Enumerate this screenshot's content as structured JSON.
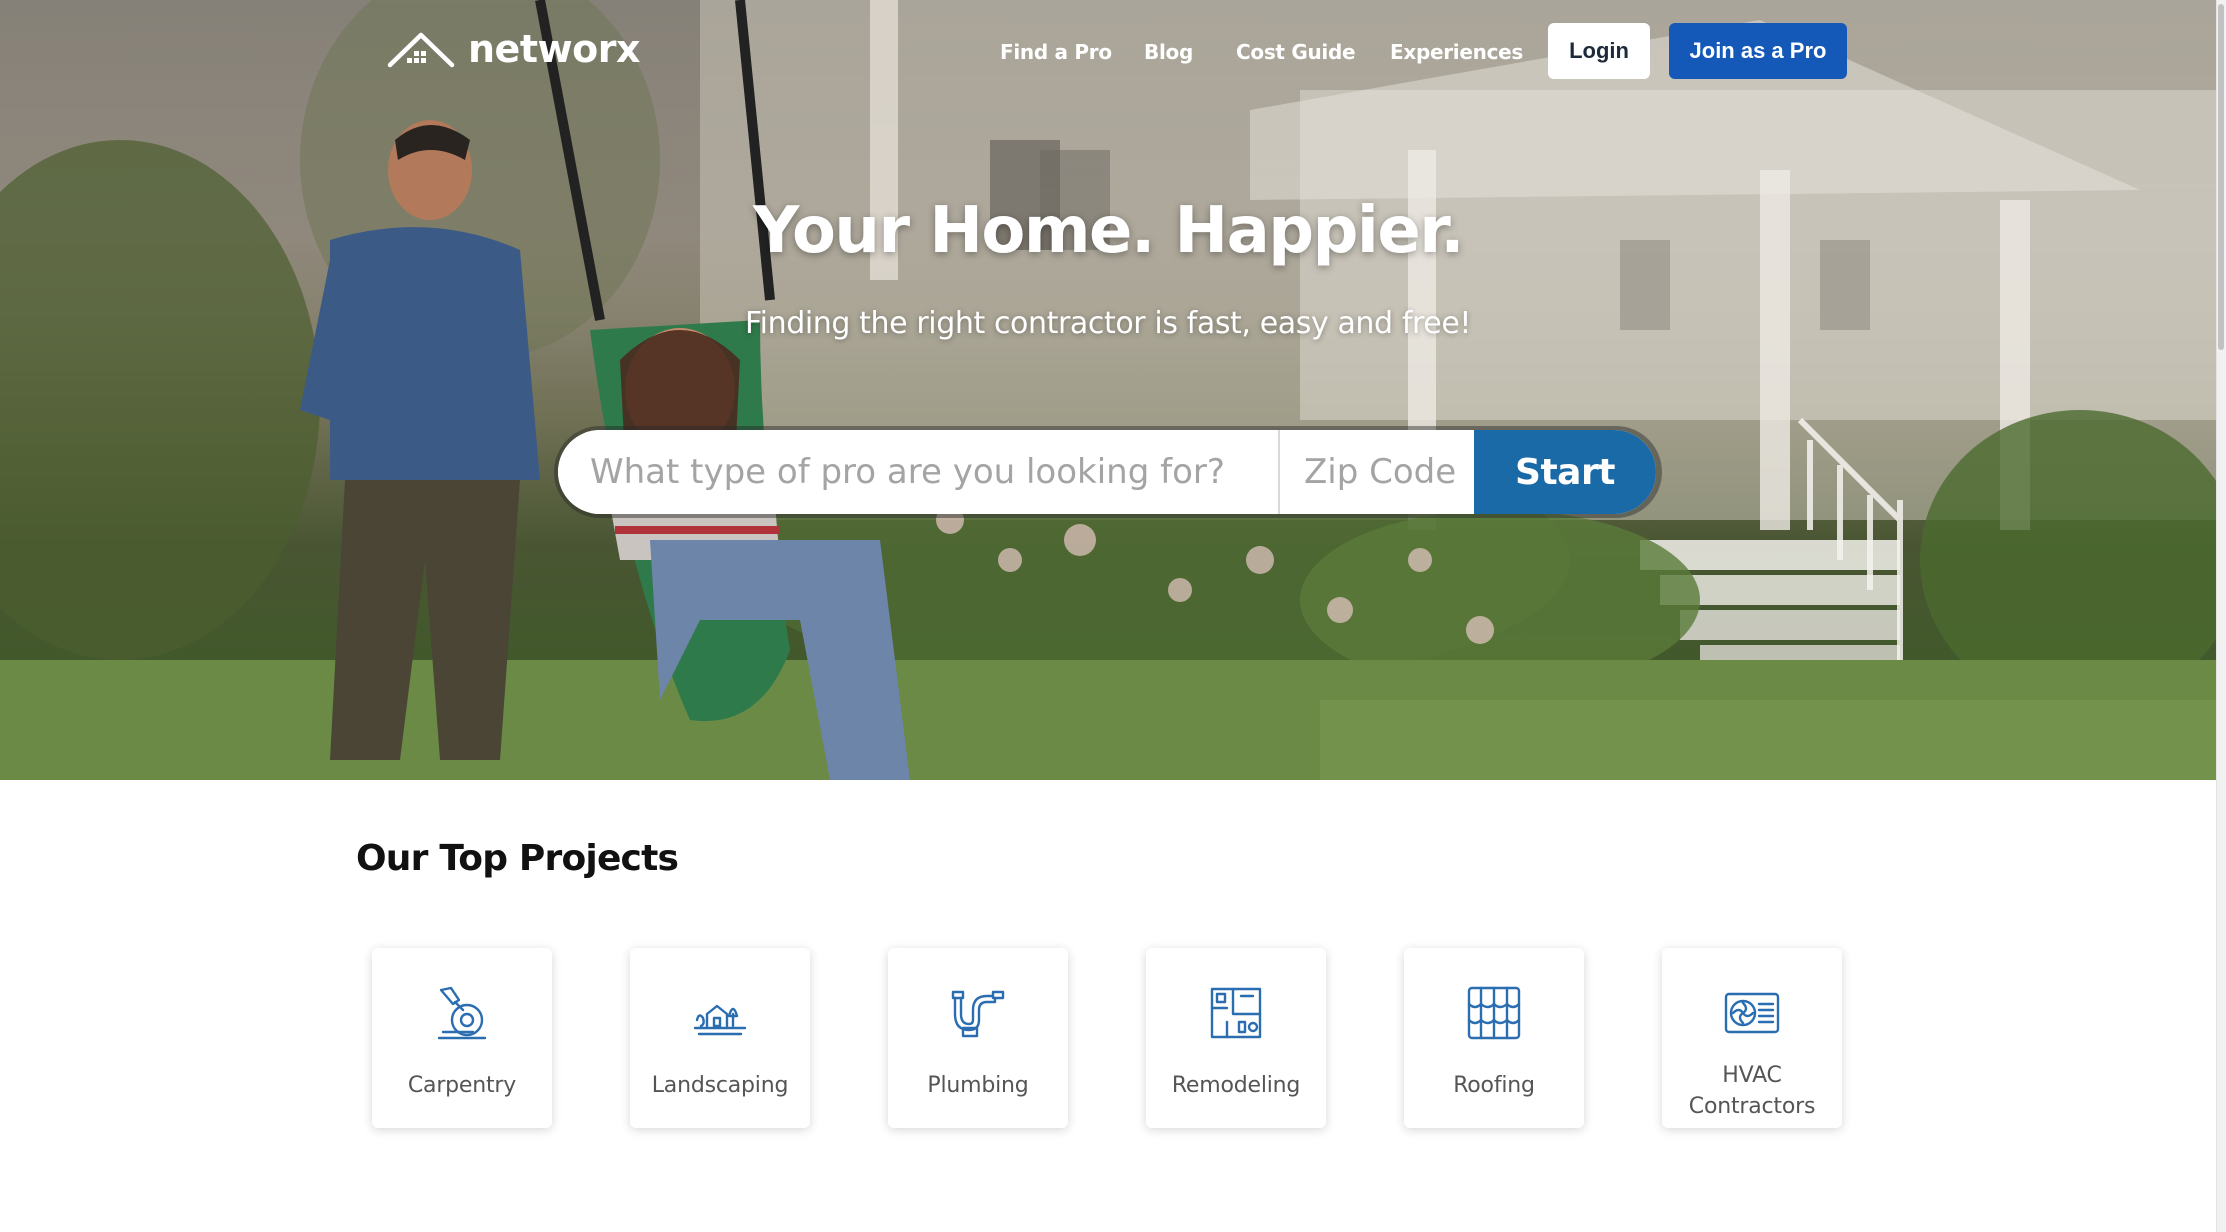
{
  "brand": {
    "name": "networx"
  },
  "nav": {
    "links": [
      "Find a Pro",
      "Blog",
      "Cost Guide",
      "Experiences"
    ],
    "login_label": "Login",
    "join_label": "Join as a Pro"
  },
  "hero": {
    "title": "Your Home. Happier.",
    "subtitle": "Finding the right contractor is fast, easy and free!",
    "search": {
      "pro_placeholder": "What type of pro are you looking for?",
      "pro_value": "",
      "zip_placeholder": "Zip Code",
      "zip_value": "",
      "start_label": "Start"
    }
  },
  "projects": {
    "title": "Our Top Projects",
    "items": [
      {
        "label": "Carpentry",
        "icon": "saw-icon"
      },
      {
        "label": "Landscaping",
        "icon": "landscape-house-icon"
      },
      {
        "label": "Plumbing",
        "icon": "pipe-icon"
      },
      {
        "label": "Remodeling",
        "icon": "floor-plan-icon"
      },
      {
        "label": "Roofing",
        "icon": "roof-tiles-icon"
      },
      {
        "label": "HVAC Contractors",
        "icon": "ac-unit-icon"
      }
    ]
  },
  "colors": {
    "accent": "#1458b8",
    "start_button": "#1a6aa8",
    "icon": "#2a6db0"
  }
}
